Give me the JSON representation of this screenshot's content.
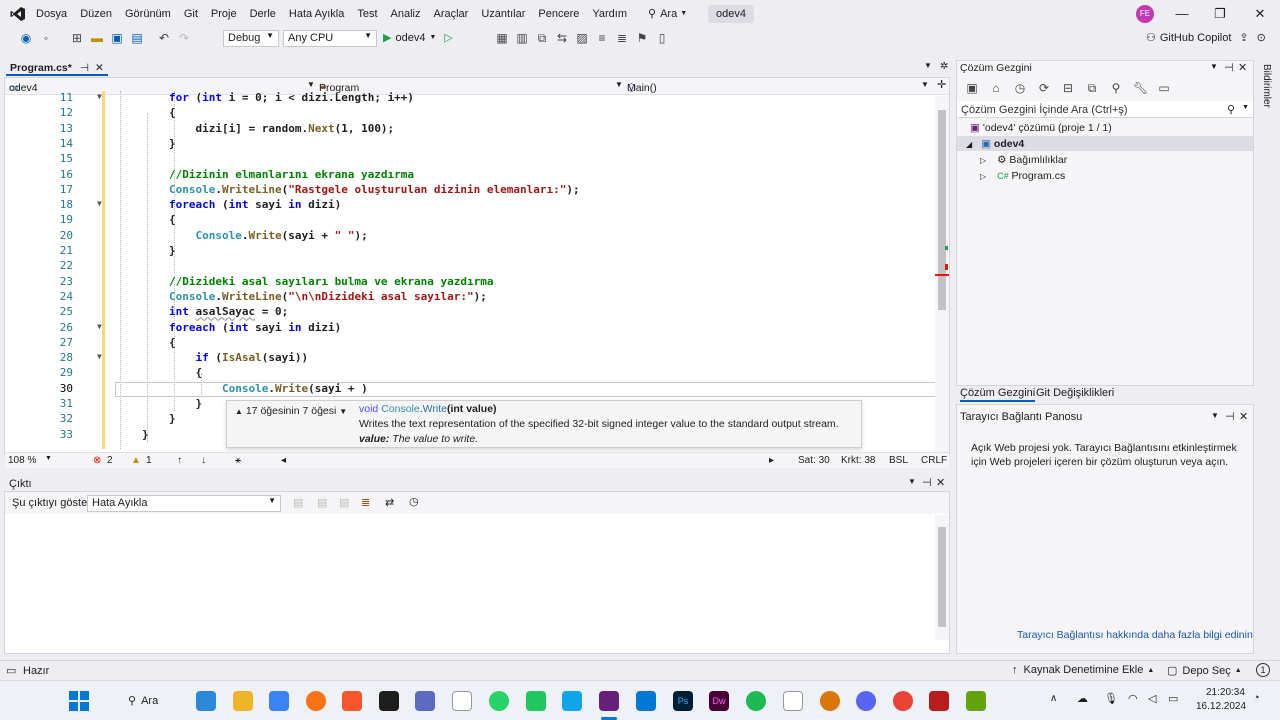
{
  "menubar": {
    "items": [
      "Dosya",
      "Düzen",
      "Görünüm",
      "Git",
      "Proje",
      "Derle",
      "Hata Ayıkla",
      "Test",
      "Analiz",
      "Araçlar",
      "Uzantılar",
      "Pencere",
      "Yardım"
    ],
    "search_label": "Ara",
    "solution_name": "odev4",
    "avatar_initials": "FE"
  },
  "toolbar": {
    "config": "Debug",
    "platform": "Any CPU",
    "run_target": "odev4",
    "copilot_label": "GitHub Copilot"
  },
  "editor": {
    "tab_title": "Program.cs*",
    "nav_project": "odev4",
    "nav_class": "Program",
    "nav_member": "Main()",
    "lines": [
      {
        "num": "11",
        "text": "for (int i = 0; i < dizi.Length; i++)"
      },
      {
        "num": "12",
        "text": "{"
      },
      {
        "num": "13",
        "text": "    dizi[i] = random.Next(1, 100);"
      },
      {
        "num": "14",
        "text": "}"
      },
      {
        "num": "15",
        "text": ""
      },
      {
        "num": "16",
        "text": "//Dizinin elmanlarını ekrana yazdırma"
      },
      {
        "num": "17",
        "text": "Console.WriteLine(\"Rastgele oluşturulan dizinin elemanları:\");"
      },
      {
        "num": "18",
        "text": "foreach (int sayi in dizi)"
      },
      {
        "num": "19",
        "text": "{"
      },
      {
        "num": "20",
        "text": "    Console.Write(sayi + \" \");"
      },
      {
        "num": "21",
        "text": "}"
      },
      {
        "num": "22",
        "text": ""
      },
      {
        "num": "23",
        "text": "//Dizideki asal sayıları bulma ve ekrana yazdırma"
      },
      {
        "num": "24",
        "text": "Console.WriteLine(\"\\n\\nDizideki asal sayılar:\");"
      },
      {
        "num": "25",
        "text": "int asalSayac = 0;"
      },
      {
        "num": "26",
        "text": "foreach (int sayi in dizi)"
      },
      {
        "num": "27",
        "text": "{"
      },
      {
        "num": "28",
        "text": "    if (IsAsal(sayi))"
      },
      {
        "num": "29",
        "text": "    {"
      },
      {
        "num": "30",
        "text": "        Console.Write(sayi + )"
      },
      {
        "num": "31",
        "text": "    }"
      },
      {
        "num": "32",
        "text": "}"
      },
      {
        "num": "33",
        "text": "}"
      }
    ],
    "tooltip": {
      "overload": "17 öğesinin 7 öğesi",
      "signature_kw": "void",
      "signature_type": "Console",
      "signature_method": "Write",
      "signature_param": "(int value)",
      "description": "Writes the text representation of the specified 32-bit signed integer value to the standard output stream.",
      "param_name": "value:",
      "param_desc": "The value to write."
    },
    "status": {
      "zoom": "108 %",
      "errors": "2",
      "warnings": "1",
      "line": "Sat: 30",
      "col": "Krkt: 38",
      "mode": "BSL",
      "eol": "CRLF"
    }
  },
  "output": {
    "title": "Çıktı",
    "show_label": "Şu çıktıyı göster:",
    "source": "Hata Ayıkla"
  },
  "solution_explorer": {
    "title": "Çözüm Gezgini",
    "search_placeholder": "Çözüm Gezgini İçinde Ara (Ctrl+ş)",
    "solution": "'odev4' çözümü (proje 1 / 1)",
    "project": "odev4",
    "dependencies": "Bağımlılıklar",
    "file": "Program.cs",
    "tab1": "Çözüm Gezgini",
    "tab2": "Git Değişiklikleri"
  },
  "browser_link": {
    "title": "Tarayıcı Bağlantı Panosu",
    "message": "Açık Web projesi yok. Tarayıcı Bağlantısını etkinleştirmek için Web projeleri içeren bir çözüm oluşturun veya açın.",
    "link": "Tarayıcı Bağlantısı hakkında daha fazla bilgi edinin"
  },
  "side_strip": {
    "label": "Bildirimler"
  },
  "statusbar": {
    "ready": "Hazır",
    "scm": "Kaynak Denetimine Ekle",
    "repo": "Depo Seç"
  },
  "taskbar": {
    "search": "Ara",
    "time": "21:20:34",
    "date": "16.12.2024"
  },
  "colors": {
    "accent": "#005fb8",
    "comment": "#008000",
    "keyword": "#0000ff",
    "string": "#a31515",
    "vs_purple": "#68217a"
  }
}
